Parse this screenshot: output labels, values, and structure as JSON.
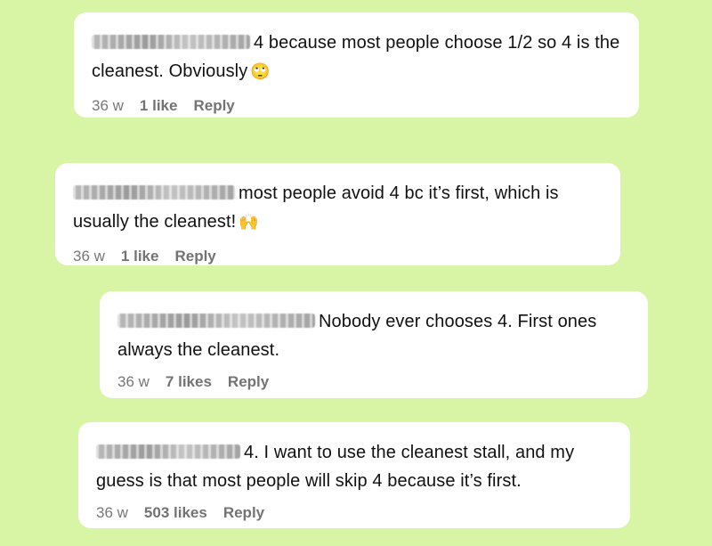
{
  "comments": [
    {
      "username": "the_eclectic_bee",
      "text": "4 because most people choose 1/2 so 4 is the cleanest. Obviously",
      "emoji": "🙄",
      "age": "36 w",
      "likes": "1 like",
      "reply": "Reply"
    },
    {
      "username": "duarmosnedjardin",
      "text": "most people avoid 4 bc it’s first, which is usually the cleanest!",
      "emoji": "🙌",
      "age": "36 w",
      "likes": "1 like",
      "reply": "Reply"
    },
    {
      "username": "adrienne.does.things",
      "text": "Nobody ever chooses 4. First ones always the cleanest.",
      "emoji": "",
      "age": "36 w",
      "likes": "7 likes",
      "reply": "Reply"
    },
    {
      "username": "nalimairdoony",
      "text": "4. I want to use the cleanest stall, and my guess is that most people will skip 4 because it’s first.",
      "emoji": "",
      "age": "36 w",
      "likes": "503 likes",
      "reply": "Reply"
    }
  ],
  "colors": {
    "background": "#d8f5a6",
    "card": "#ffffff",
    "text": "#111111",
    "meta": "#777777"
  }
}
